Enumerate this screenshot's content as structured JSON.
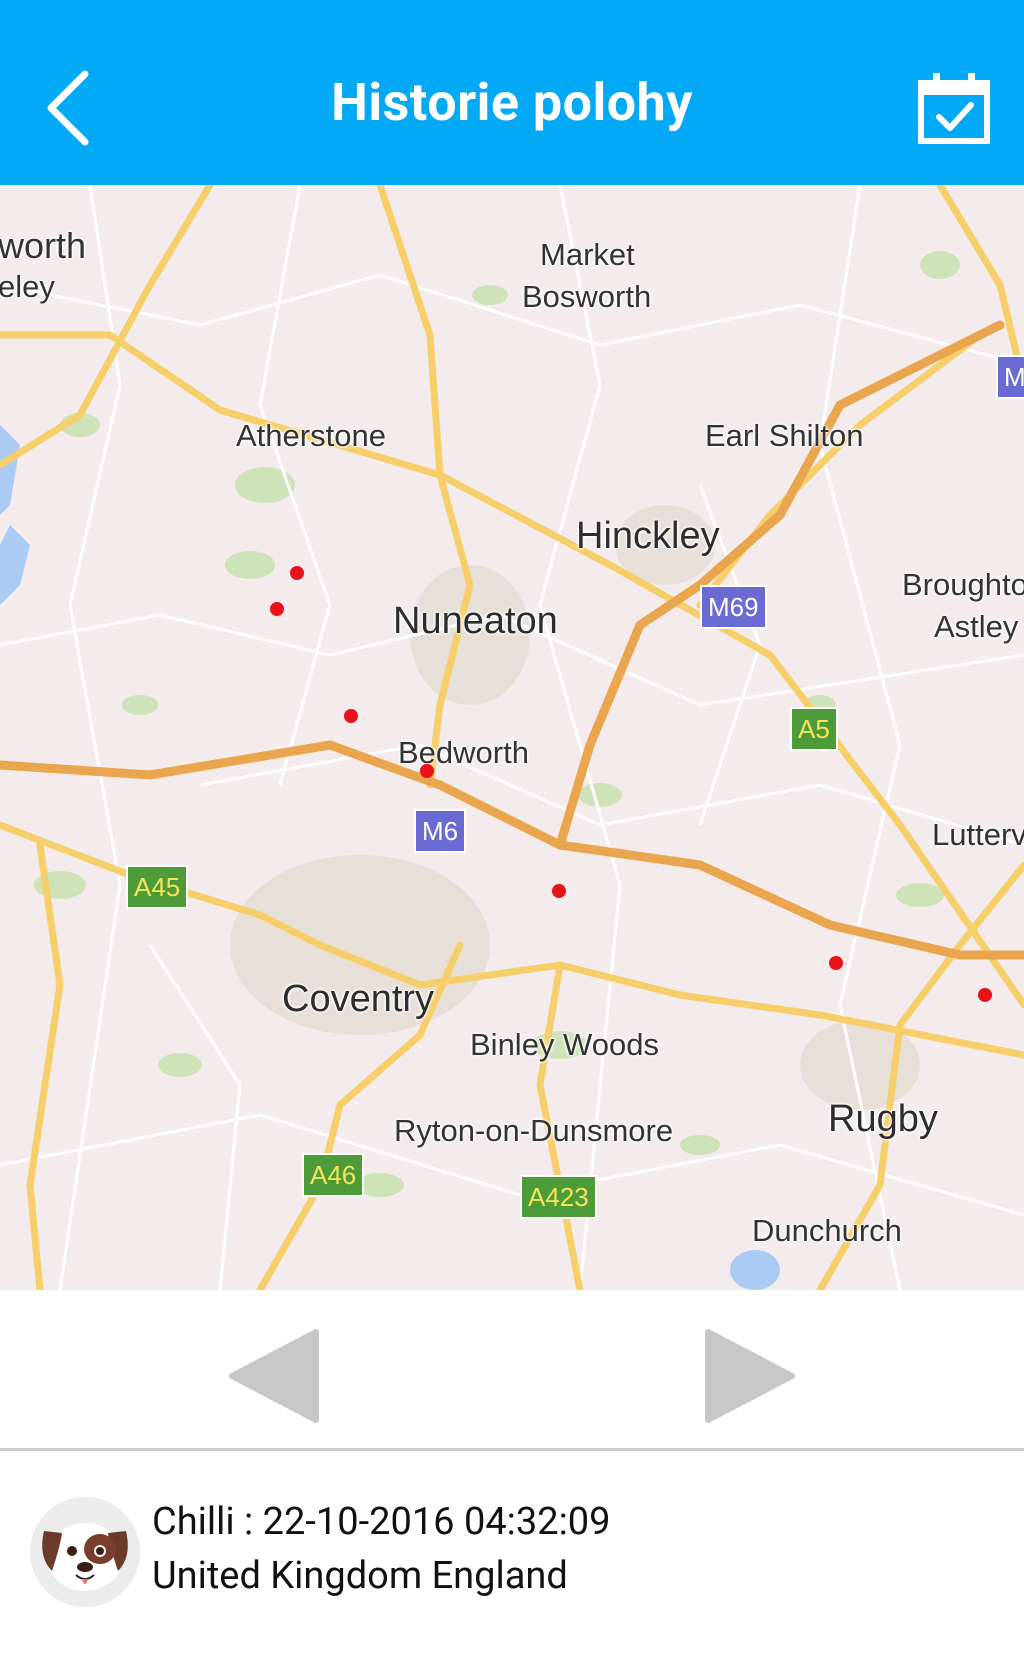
{
  "header": {
    "title": "Historie polohy",
    "back_icon": "chevron-left-icon",
    "calendar_icon": "calendar-check-icon",
    "background_color": "#03A9F4"
  },
  "map": {
    "labels": {
      "worth": "worth",
      "eley": "eley",
      "market_bosworth_1": "Market",
      "market_bosworth_2": "Bosworth",
      "atherstone": "Atherstone",
      "earl_shilton": "Earl Shilton",
      "hinckley": "Hinckley",
      "nuneaton": "Nuneaton",
      "broughton_1": "Broughto",
      "broughton_2": "Astley",
      "bedworth": "Bedworth",
      "lutterworth": "Lutterv",
      "coventry": "Coventry",
      "binley_woods": "Binley Woods",
      "ryton": "Ryton-on-Dunsmore",
      "rugby": "Rugby",
      "dunchurch": "Dunchurch"
    },
    "road_shields": {
      "m_top": "M",
      "m69": "M69",
      "a5": "A5",
      "m6": "M6",
      "a45": "A45",
      "a46": "A46",
      "a423": "A423"
    },
    "track_point_color": "#e8121a"
  },
  "controls": {
    "prev_icon": "triangle-left-icon",
    "next_icon": "triangle-right-icon"
  },
  "info": {
    "avatar_icon": "dog-face-icon",
    "line1": "Chilli : 22-10-2016 04:32:09",
    "line2": "United Kingdom England"
  }
}
